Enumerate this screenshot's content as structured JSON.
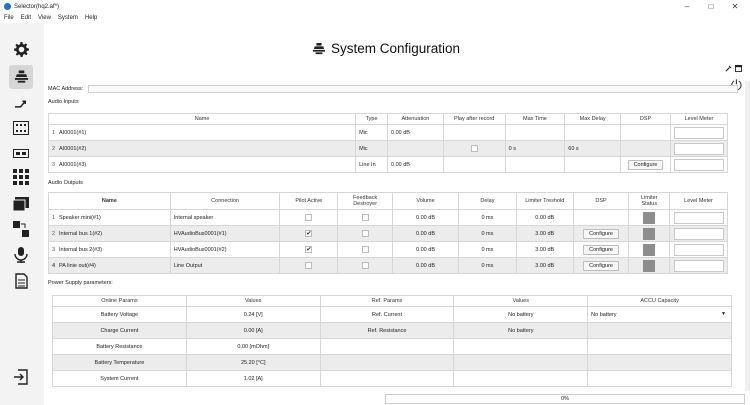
{
  "window": {
    "title": "Selector(hq2.af*)",
    "minimize": "–",
    "maximize": "□",
    "close": "✕"
  },
  "menu": [
    "File",
    "Edit",
    "View",
    "System",
    "Help"
  ],
  "page": {
    "title": "System Configuration"
  },
  "mac": {
    "label": "MAC Address:",
    "value": ""
  },
  "inputs": {
    "label": "Audio Inputs",
    "headers": [
      "Name",
      "Type",
      "Attenuation",
      "Play after record",
      "Max Time",
      "Max Delay",
      "DSP",
      "Level Meter"
    ],
    "rows": [
      {
        "idx": "1",
        "name": "AI0001(#1)",
        "type": "Mic",
        "att": "0.00 dB",
        "play": "",
        "maxtime": "",
        "maxdelay": "",
        "dsp": ""
      },
      {
        "idx": "2",
        "name": "AI0001(#2)",
        "type": "Mic",
        "att": "",
        "play": "checkbox",
        "maxtime": "0 s",
        "maxdelay": "60 s",
        "dsp": ""
      },
      {
        "idx": "3",
        "name": "AI0001(#3)",
        "type": "Line In",
        "att": "0.00 dB",
        "play": "",
        "maxtime": "",
        "maxdelay": "",
        "dsp": "Configure"
      }
    ]
  },
  "outputs": {
    "label": "Audio Outputs",
    "headers": [
      "Name",
      "Connection",
      "Pilot Active",
      "Feedback Destroyer",
      "Volume",
      "Delay",
      "Limiter Treshold",
      "DSP",
      "Limiter Status",
      "Level Meter"
    ],
    "rows": [
      {
        "idx": "1",
        "name": "Speaker mini(#1)",
        "conn": "Internal speaker",
        "pilot": false,
        "fb": false,
        "vol": "0.00 dB",
        "delay": "0 ms",
        "lim": "0.00 dB",
        "dsp": ""
      },
      {
        "idx": "2",
        "name": "Internal bus 1(#2)",
        "conn": "HVAudioBus0001(#1)",
        "pilot": true,
        "fb": false,
        "vol": "0.00 dB",
        "delay": "0 ms",
        "lim": "3.00 dB",
        "dsp": "Configure"
      },
      {
        "idx": "3",
        "name": "Internal bus 2(#3)",
        "conn": "HVAudioBus0001(#2)",
        "pilot": true,
        "fb": false,
        "vol": "0.00 dB",
        "delay": "0 ms",
        "lim": "3.00 dB",
        "dsp": "Configure"
      },
      {
        "idx": "4",
        "name": "PA linie out(#4)",
        "conn": "Line Output",
        "pilot": false,
        "fb": false,
        "vol": "0.00 dB",
        "delay": "0 ms",
        "lim": "3.00 dB",
        "dsp": "Configure"
      }
    ]
  },
  "power": {
    "label": "Power Supply parameters:",
    "headers": [
      "Online Params",
      "Values",
      "Ref. Params",
      "Values",
      "ACCU Capacity"
    ],
    "accu_value": "No battery",
    "rows": [
      {
        "param": "Battery Voltage",
        "value": "0.24 [V]",
        "ref": "Ref. Current",
        "refval": "No battery"
      },
      {
        "param": "Charge Current",
        "value": "0.00 [A]",
        "ref": "Ref. Resistance",
        "refval": "No battery"
      },
      {
        "param": "Battery Resistance",
        "value": "0.00 [mOhm]",
        "ref": "",
        "refval": ""
      },
      {
        "param": "Battery Temperature",
        "value": "25.20 [°C]",
        "ref": "",
        "refval": ""
      },
      {
        "param": "System Current",
        "value": "1.02 [A]",
        "ref": "",
        "refval": ""
      }
    ]
  },
  "status": {
    "progress": "0%"
  },
  "colors": {
    "accent": "#1f6fd0",
    "grid": "#d6d6d6",
    "limiter_status": "#8d8d8d"
  }
}
